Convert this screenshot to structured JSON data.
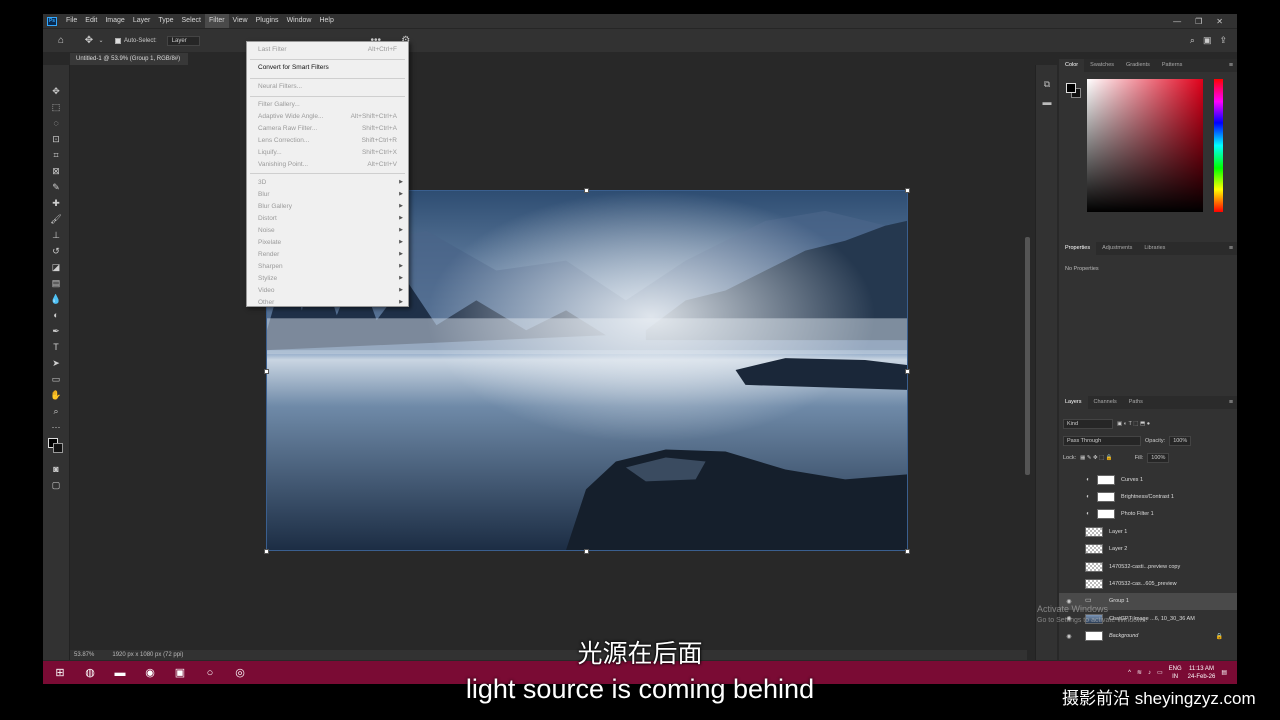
{
  "app": {
    "logo": "Ps"
  },
  "menubar": [
    "File",
    "Edit",
    "Image",
    "Layer",
    "Type",
    "Select",
    "Filter",
    "View",
    "Plugins",
    "Window",
    "Help"
  ],
  "window_controls": [
    "—",
    "❐",
    "✕"
  ],
  "options_bar": {
    "auto_select_label": "Auto-Select:",
    "auto_select_value": "Layer"
  },
  "document": {
    "tab_title": "Untitled-1 @ 53.9% (Group 1, RGB/8#)",
    "zoom": "53.87%",
    "info": "1920 px x 1080 px (72 ppi)"
  },
  "filter_menu": {
    "items": [
      {
        "label": "Last Filter",
        "shortcut": "Alt+Ctrl+F",
        "enabled": false
      },
      {
        "label": "Convert for Smart Filters",
        "shortcut": "",
        "enabled": true
      },
      {
        "label": "Neural Filters...",
        "shortcut": "",
        "enabled": false
      },
      {
        "label": "Filter Gallery...",
        "shortcut": "",
        "enabled": false
      },
      {
        "label": "Adaptive Wide Angle...",
        "shortcut": "Alt+Shift+Ctrl+A",
        "enabled": false
      },
      {
        "label": "Camera Raw Filter...",
        "shortcut": "Shift+Ctrl+A",
        "enabled": false
      },
      {
        "label": "Lens Correction...",
        "shortcut": "Shift+Ctrl+R",
        "enabled": false
      },
      {
        "label": "Liquify...",
        "shortcut": "Shift+Ctrl+X",
        "enabled": false
      },
      {
        "label": "Vanishing Point...",
        "shortcut": "Alt+Ctrl+V",
        "enabled": false
      },
      {
        "label": "3D",
        "submenu": true
      },
      {
        "label": "Blur",
        "submenu": true
      },
      {
        "label": "Blur Gallery",
        "submenu": true
      },
      {
        "label": "Distort",
        "submenu": true
      },
      {
        "label": "Noise",
        "submenu": true
      },
      {
        "label": "Pixelate",
        "submenu": true
      },
      {
        "label": "Render",
        "submenu": true
      },
      {
        "label": "Sharpen",
        "submenu": true
      },
      {
        "label": "Stylize",
        "submenu": true
      },
      {
        "label": "Video",
        "submenu": true
      },
      {
        "label": "Other",
        "submenu": true
      }
    ]
  },
  "color_panel": {
    "tabs": [
      "Color",
      "Swatches",
      "Gradients",
      "Patterns"
    ]
  },
  "properties_panel": {
    "tabs": [
      "Properties",
      "Adjustments",
      "Libraries"
    ],
    "empty_text": "No Properties"
  },
  "layers_panel": {
    "tabs": [
      "Layers",
      "Channels",
      "Paths"
    ],
    "filter_kind": "Kind",
    "blend_mode": "Pass Through",
    "opacity_label": "Opacity:",
    "opacity_value": "100%",
    "lock_label": "Lock:",
    "fill_label": "Fill:",
    "fill_value": "100%",
    "layers": [
      {
        "name": "Curves 1",
        "thumb": "adj",
        "visible": false
      },
      {
        "name": "Brightness/Contrast 1",
        "thumb": "adj",
        "visible": false
      },
      {
        "name": "Photo Filter 1",
        "thumb": "adj",
        "visible": false
      },
      {
        "name": "Layer 1",
        "thumb": "trans",
        "visible": false
      },
      {
        "name": "Layer 2",
        "thumb": "trans",
        "visible": false
      },
      {
        "name": "1470532-casti...preview copy",
        "thumb": "trans",
        "visible": false
      },
      {
        "name": "1470532-cas...605_preview",
        "thumb": "trans",
        "visible": false
      },
      {
        "name": "Group 1",
        "thumb": "folder",
        "visible": true,
        "selected": true
      },
      {
        "name": "ChatGPT Image ...6, 10_30_36 AM",
        "thumb": "img",
        "visible": true
      },
      {
        "name": "Background",
        "thumb": "white",
        "visible": true,
        "locked": true
      }
    ]
  },
  "watermark_activate": {
    "line1": "Activate Windows",
    "line2": "Go to Settings to activate Windows."
  },
  "taskbar": {
    "lang": "ENG",
    "region": "IN",
    "time": "11:13 AM",
    "date": "24-Feb-26"
  },
  "subtitles": {
    "cn": "光源在后面",
    "en": "light source is coming behind"
  },
  "site_watermark": "摄影前沿 sheyingzyz.com"
}
